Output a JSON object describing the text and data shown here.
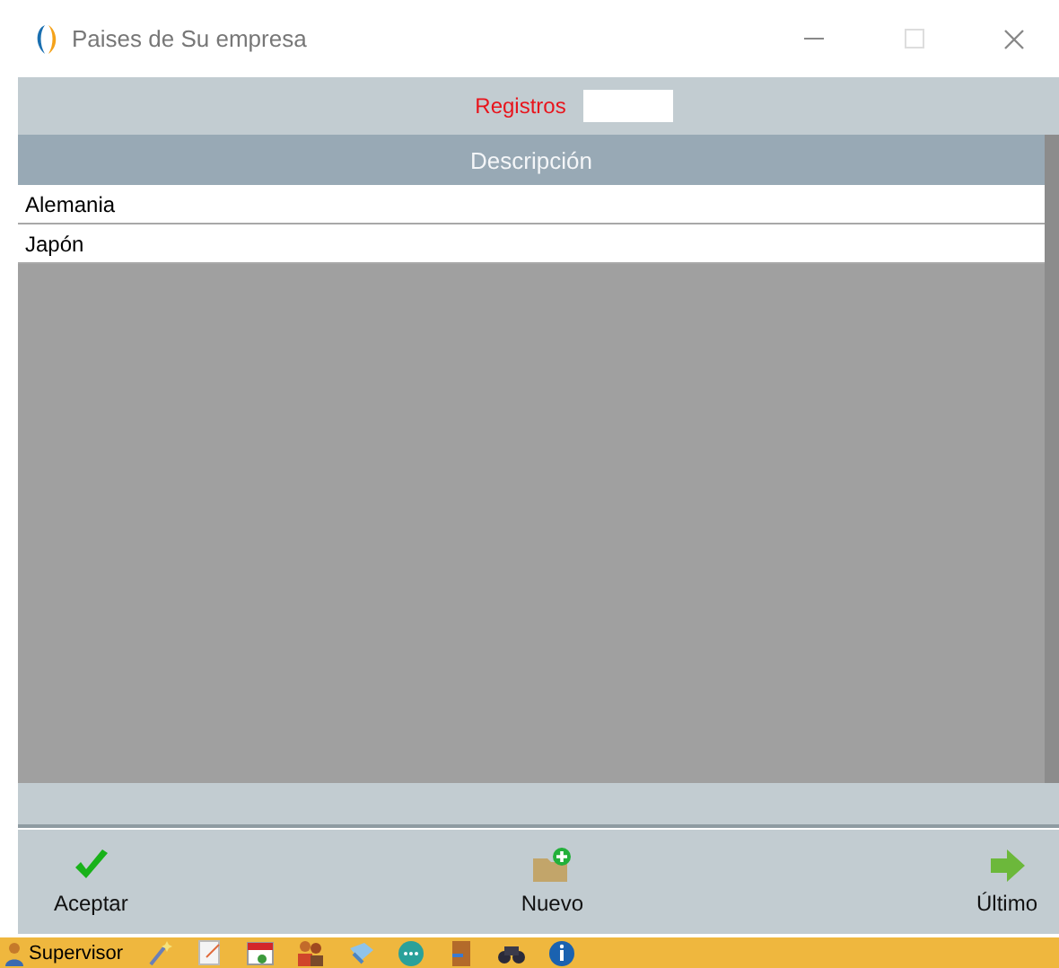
{
  "window": {
    "title": "Paises de Su empresa"
  },
  "records": {
    "label": "Registros"
  },
  "table": {
    "columns": [
      "Descripción"
    ],
    "rows": [
      [
        "Alemania"
      ],
      [
        "Japón"
      ]
    ]
  },
  "toolbar": [
    {
      "kind": "accept",
      "label": "Aceptar"
    },
    {
      "kind": "new",
      "label": "Nuevo"
    },
    {
      "kind": "last",
      "label": "Último"
    }
  ],
  "taskbar": {
    "user": "Supervisor",
    "icons": [
      {
        "kind": "wand"
      },
      {
        "kind": "note"
      },
      {
        "kind": "calendar"
      },
      {
        "kind": "people"
      },
      {
        "kind": "tools"
      },
      {
        "kind": "chat"
      },
      {
        "kind": "door"
      },
      {
        "kind": "binoculars"
      },
      {
        "kind": "info"
      }
    ]
  }
}
